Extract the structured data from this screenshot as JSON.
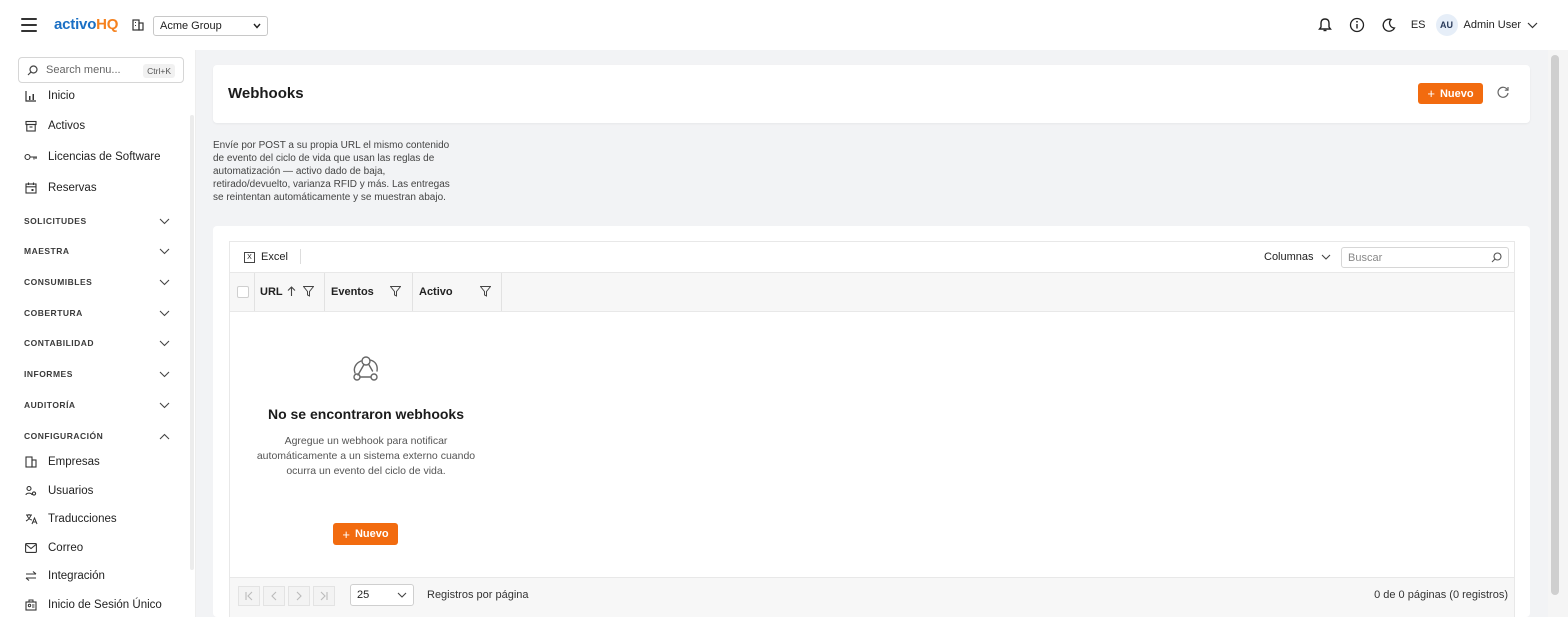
{
  "app": {
    "logo_part1": "activo",
    "logo_part2": "HQ",
    "company": "Acme Group",
    "language": "ES",
    "user_initials": "AU",
    "user_name": "Admin User",
    "brand_color": "#1a6fc4",
    "accent_color": "#f26b0f"
  },
  "sidebar": {
    "search_placeholder": "Search menu...",
    "search_shortcut": "Ctrl+K",
    "items_top": [
      {
        "label": "Inicio",
        "icon": "chart-icon"
      },
      {
        "label": "Activos",
        "icon": "archive-icon"
      },
      {
        "label": "Licencias de Software",
        "icon": "key-icon"
      },
      {
        "label": "Reservas",
        "icon": "calendar-icon"
      }
    ],
    "groups": [
      "SOLICITUDES",
      "MAESTRA",
      "CONSUMIBLES",
      "COBERTURA",
      "CONTABILIDAD",
      "INFORMES",
      "AUDITORÍA",
      "CONFIGURACIÓN"
    ],
    "config_items": [
      {
        "label": "Empresas",
        "icon": "building-icon"
      },
      {
        "label": "Usuarios",
        "icon": "users-icon"
      },
      {
        "label": "Traducciones",
        "icon": "translate-icon"
      },
      {
        "label": "Correo",
        "icon": "mail-icon"
      },
      {
        "label": "Integración",
        "icon": "swap-icon"
      },
      {
        "label": "Inicio de Sesión Único",
        "icon": "sso-icon"
      }
    ]
  },
  "page": {
    "title": "Webhooks",
    "new_label": "Nuevo",
    "description": "Envíe por POST a su propia URL el mismo contenido de evento del ciclo de vida que usan las reglas de automatización — activo dado de baja, retirado/devuelto, varianza RFID y más. Las entregas se reintentan automáticamente y se muestran abajo."
  },
  "grid": {
    "excel_label": "Excel",
    "columns_label": "Columnas",
    "search_placeholder": "Buscar",
    "headers": [
      "URL",
      "Eventos",
      "Activo"
    ],
    "empty_title": "No se encontraron webhooks",
    "empty_text": "Agregue un webhook para notificar automáticamente a un sistema externo cuando ocurra un evento del ciclo de vida.",
    "empty_button": "Nuevo",
    "page_size": "25",
    "rows_per_page_label": "Registros por página",
    "page_info": "0 de 0 páginas (0 registros)"
  }
}
